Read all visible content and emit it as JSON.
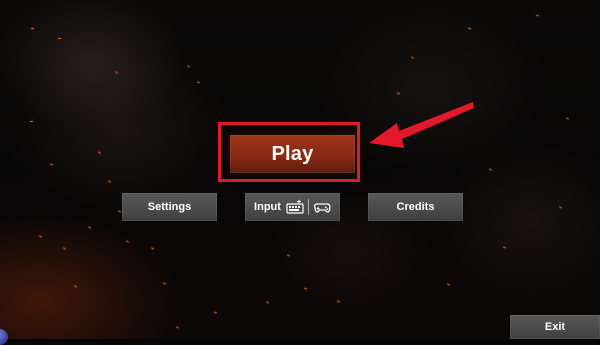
{
  "menu": {
    "play_label": "Play",
    "settings_label": "Settings",
    "input_label": "Input",
    "credits_label": "Credits",
    "exit_label": "Exit"
  },
  "input_button_icons": [
    "keyboard-icon",
    "gamepad-icon"
  ],
  "annotations": {
    "highlighted_element": "play-button",
    "highlight_color": "#e3192b",
    "arrow_color": "#e3192b"
  },
  "colors": {
    "play_button": "#8f2d16",
    "secondary_button": "#4b4b4b",
    "text": "#ffffff"
  }
}
